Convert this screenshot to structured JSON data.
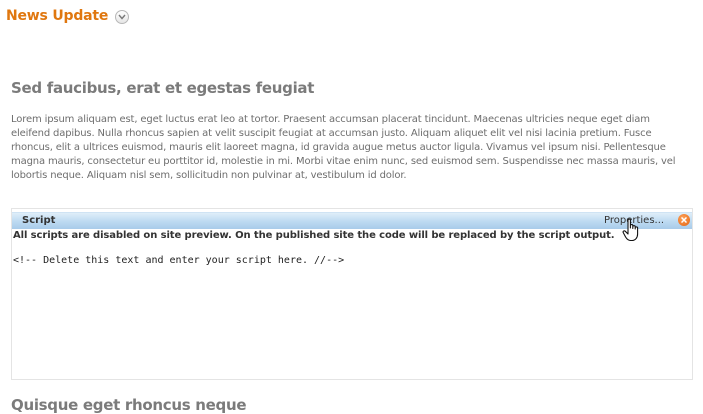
{
  "header": {
    "title": "News Update",
    "toggle_icon": "chevron-down-icon"
  },
  "article": {
    "heading": "Sed faucibus, erat et egestas feugiat",
    "paragraph": "Lorem ipsum aliquam est, eget luctus erat leo at tortor. Praesent accumsan placerat tincidunt. Maecenas ultricies neque eget diam eleifend dapibus. Nulla rhoncus sapien at velit suscipit feugiat at accumsan justo. Aliquam aliquet elit vel nisi lacinia pretium. Fusce rhoncus, elit a ultrices euismod, mauris elit laoreet magna, id gravida augue metus auctor ligula. Vivamus vel ipsum nisi. Pellentesque magna mauris, consectetur eu porttitor id, molestie in mi. Morbi vitae enim nunc, sed euismod sem. Suspendisse nec massa mauris, vel lobortis neque. Aliquam nisl sem, sollicitudin non pulvinar at, vestibulum id dolor."
  },
  "script_widget": {
    "label": "Script",
    "properties_label": "Properties...",
    "close_icon": "close-icon",
    "warning": "All scripts are disabled on site preview. On the published site the code will be replaced by the script output.",
    "code": "<!-- Delete this text and enter your script here. //-->",
    "header_color": "#bcd9f1",
    "close_color": "#e2620f"
  },
  "next_section": {
    "heading": "Quisque eget rhoncus neque"
  },
  "colors": {
    "accent": "#e0770f",
    "heading_gray": "#7b7b7b"
  }
}
